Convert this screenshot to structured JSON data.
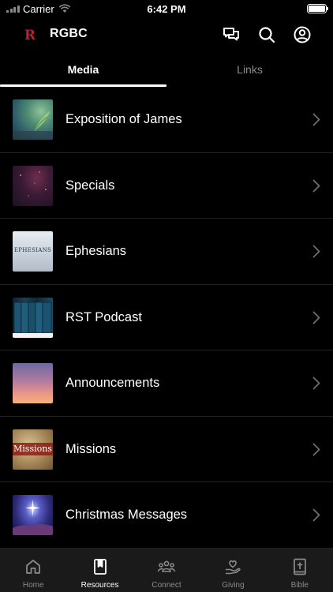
{
  "status_bar": {
    "carrier": "Carrier",
    "time": "6:42 PM"
  },
  "header": {
    "title": "RGBC",
    "logo_letter": "R",
    "accent_color": "#b3262f"
  },
  "tabs": [
    {
      "label": "Media",
      "active": true
    },
    {
      "label": "Links",
      "active": false
    }
  ],
  "media_list": [
    {
      "label": "Exposition of James"
    },
    {
      "label": "Specials"
    },
    {
      "label": "Ephesians",
      "thumb_text": "EPHESIANS"
    },
    {
      "label": "RST Podcast"
    },
    {
      "label": "Announcements"
    },
    {
      "label": "Missions",
      "thumb_text": "Missions"
    },
    {
      "label": "Christmas Messages"
    }
  ],
  "tab_bar": [
    {
      "label": "Home",
      "icon": "home-icon",
      "active": false
    },
    {
      "label": "Resources",
      "icon": "bookmark-icon",
      "active": true
    },
    {
      "label": "Connect",
      "icon": "group-icon",
      "active": false
    },
    {
      "label": "Giving",
      "icon": "heart-hand-icon",
      "active": false
    },
    {
      "label": "Bible",
      "icon": "bible-icon",
      "active": false
    }
  ]
}
